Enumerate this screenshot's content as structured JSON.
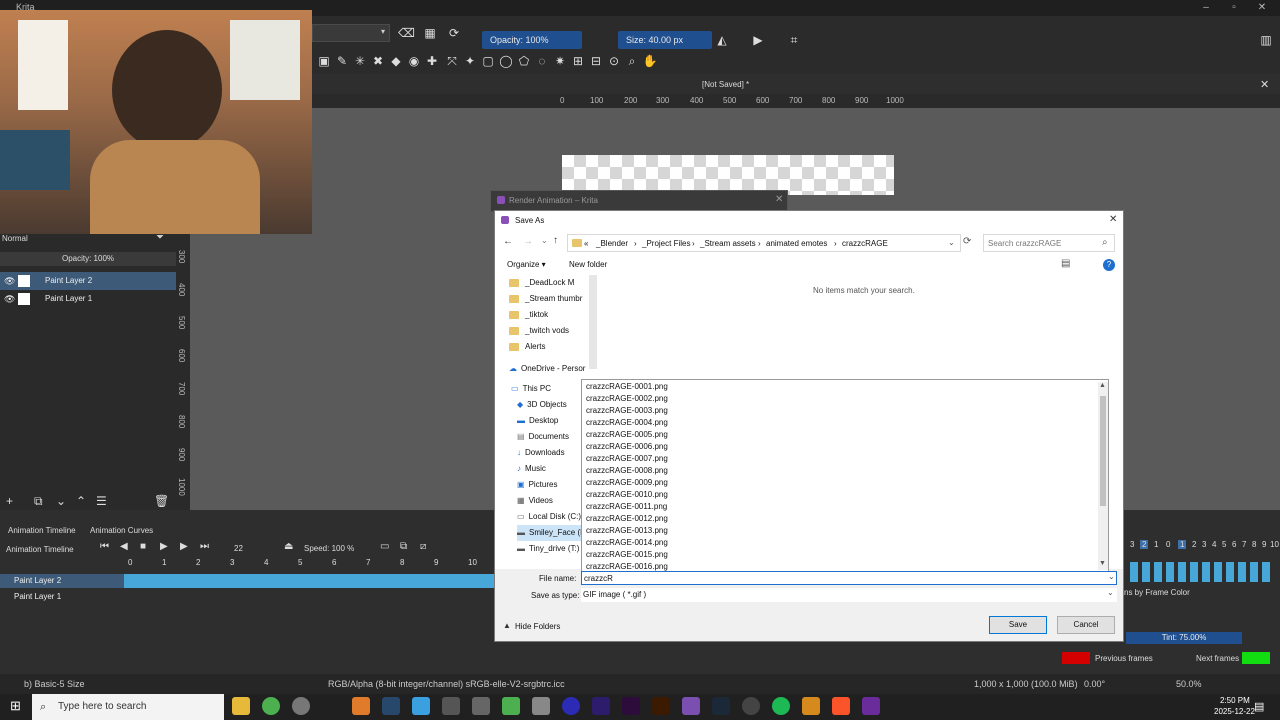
{
  "app": {
    "title": "Krita",
    "doc_title": "[Not Saved] *"
  },
  "toolbar": {
    "opacity": "Opacity: 100%",
    "size": "Size: 40.00 px"
  },
  "ruler": {
    "top_ticks": [
      "0",
      "100",
      "200",
      "300",
      "400",
      "500",
      "600",
      "700",
      "800",
      "900",
      "1000"
    ],
    "left_ticks": [
      "300",
      "400",
      "500",
      "600",
      "700",
      "800",
      "900",
      "1000"
    ]
  },
  "layers": {
    "blend_mode": "Normal",
    "opacity": "Opacity: 100%",
    "items": [
      "Paint Layer 2",
      "Paint Layer 1"
    ]
  },
  "animation": {
    "tab1": "Animation Timeline",
    "tab2": "Animation Curves",
    "title": "Animation Timeline",
    "frame": "22",
    "speed": "Speed: 100 %",
    "frames": [
      "0",
      "1",
      "2",
      "3",
      "4",
      "5",
      "6",
      "7",
      "8",
      "9",
      "10"
    ],
    "rows": [
      "Paint Layer 2",
      "Paint Layer 1"
    ]
  },
  "onion": {
    "numbers": [
      "3",
      "2",
      "1",
      "0",
      "1",
      "2",
      "3",
      "4",
      "5",
      "6",
      "7",
      "8",
      "9",
      "10"
    ],
    "frame_color": "ns by Frame Color",
    "tint": "Tint: 75.00%",
    "previous": "Previous frames",
    "next": "Next frames",
    "prev_color": "#d40000",
    "next_color": "#11dd11"
  },
  "render_window": {
    "title": "Render Animation – Krita"
  },
  "save_dialog": {
    "title": "Save As",
    "breadcrumb": [
      "«",
      "_Blender",
      "_Project Files",
      "_Stream assets",
      "animated emotes",
      "crazzcRAGE"
    ],
    "search_placeholder": "Search crazzcRAGE",
    "organize": "Organize ▾",
    "new_folder": "New folder",
    "empty_msg": "No items match your search.",
    "sidebar": [
      "_DeadLock M",
      "_Stream thumbr",
      "_tiktok",
      "_twitch vods",
      "Alerts",
      "OneDrive - Persor",
      "This PC",
      "3D Objects",
      "Desktop",
      "Documents",
      "Downloads",
      "Music",
      "Pictures",
      "Videos",
      "Local Disk (C:)",
      "Smiley_Face (E",
      "Tiny_drive (T:)"
    ],
    "suggestions": [
      "crazzcRAGE-0001.png",
      "crazzcRAGE-0002.png",
      "crazzcRAGE-0003.png",
      "crazzcRAGE-0004.png",
      "crazzcRAGE-0005.png",
      "crazzcRAGE-0006.png",
      "crazzcRAGE-0007.png",
      "crazzcRAGE-0008.png",
      "crazzcRAGE-0009.png",
      "crazzcRAGE-0010.png",
      "crazzcRAGE-0011.png",
      "crazzcRAGE-0012.png",
      "crazzcRAGE-0013.png",
      "crazzcRAGE-0014.png",
      "crazzcRAGE-0015.png",
      "crazzcRAGE-0016.png"
    ],
    "file_name_label": "File name:",
    "file_name_value": "crazzcR",
    "type_label": "Save as type:",
    "type_value": "GIF image ( *.gif )",
    "hide_folders": "Hide Folders",
    "save": "Save",
    "cancel": "Cancel"
  },
  "status": {
    "brush": "b) Basic-5 Size",
    "color": "RGB/Alpha (8-bit integer/channel)  sRGB-elle-V2-srgbtrc.icc",
    "dims": "1,000 x 1,000 (100.0 MiB)",
    "angle": "0.00°",
    "zoom": "50.0%"
  },
  "taskbar": {
    "search": "Type here to search",
    "time": "2:50 PM",
    "date": "2025-12-22"
  }
}
